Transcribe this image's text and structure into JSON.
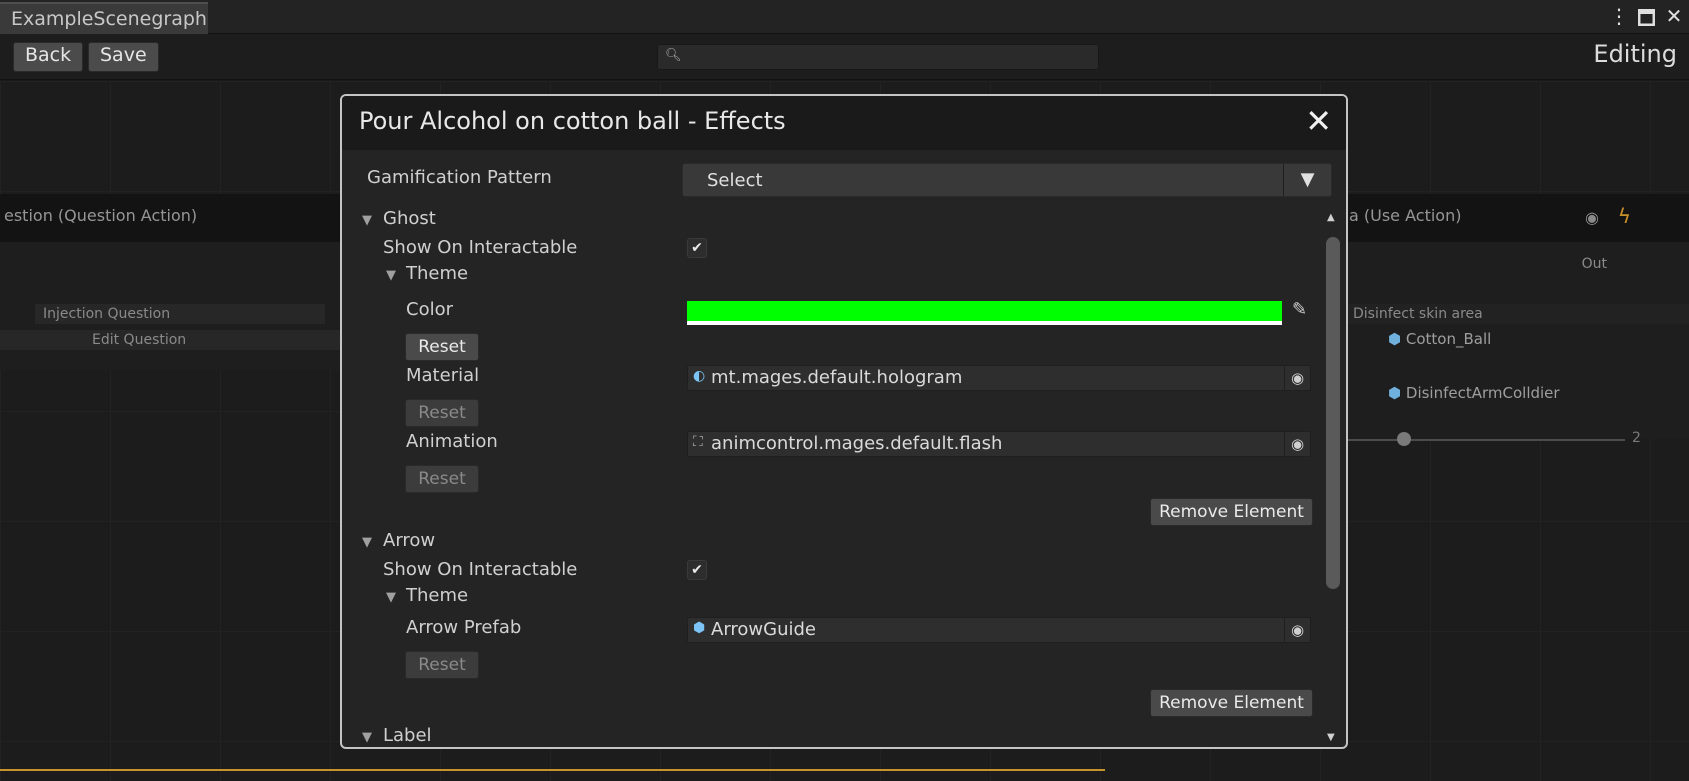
{
  "window": {
    "tab_title": "ExampleScenegraph",
    "controls": {
      "menu": "⋮",
      "maximize": "🗖",
      "close": "✕"
    }
  },
  "toolbar": {
    "back_label": "Back",
    "save_label": "Save",
    "search_placeholder": "",
    "mode_label": "Editing"
  },
  "graph": {
    "left_node": {
      "title": "estion (Question Action)",
      "rows": [
        "Injection Question",
        "Edit Question"
      ]
    },
    "right_node": {
      "title": "a (Use Action)",
      "out_label": "Out",
      "step_label": "Disinfect skin area",
      "objects": [
        "Cotton_Ball",
        "DisinfectArmColldier"
      ],
      "slider_value": "2"
    }
  },
  "modal": {
    "title": "Pour Alcohol on cotton ball - Effects",
    "gamification_label": "Gamification Pattern",
    "gamification_value": "Select",
    "ghost": {
      "header": "Ghost",
      "show_on_interactable_label": "Show On Interactable",
      "show_on_interactable": true,
      "theme_label": "Theme",
      "color_label": "Color",
      "color_value": "#00ff00",
      "reset_label": "Reset",
      "material_label": "Material",
      "material_value": "mt.mages.default.hologram",
      "animation_label": "Animation",
      "animation_value": "animcontrol.mages.default.flash",
      "remove_label": "Remove Element"
    },
    "arrow": {
      "header": "Arrow",
      "show_on_interactable_label": "Show On Interactable",
      "show_on_interactable": true,
      "theme_label": "Theme",
      "prefab_label": "Arrow Prefab",
      "prefab_value": "ArrowGuide",
      "reset_label": "Reset",
      "remove_label": "Remove Element"
    },
    "label_section_header": "Label"
  }
}
